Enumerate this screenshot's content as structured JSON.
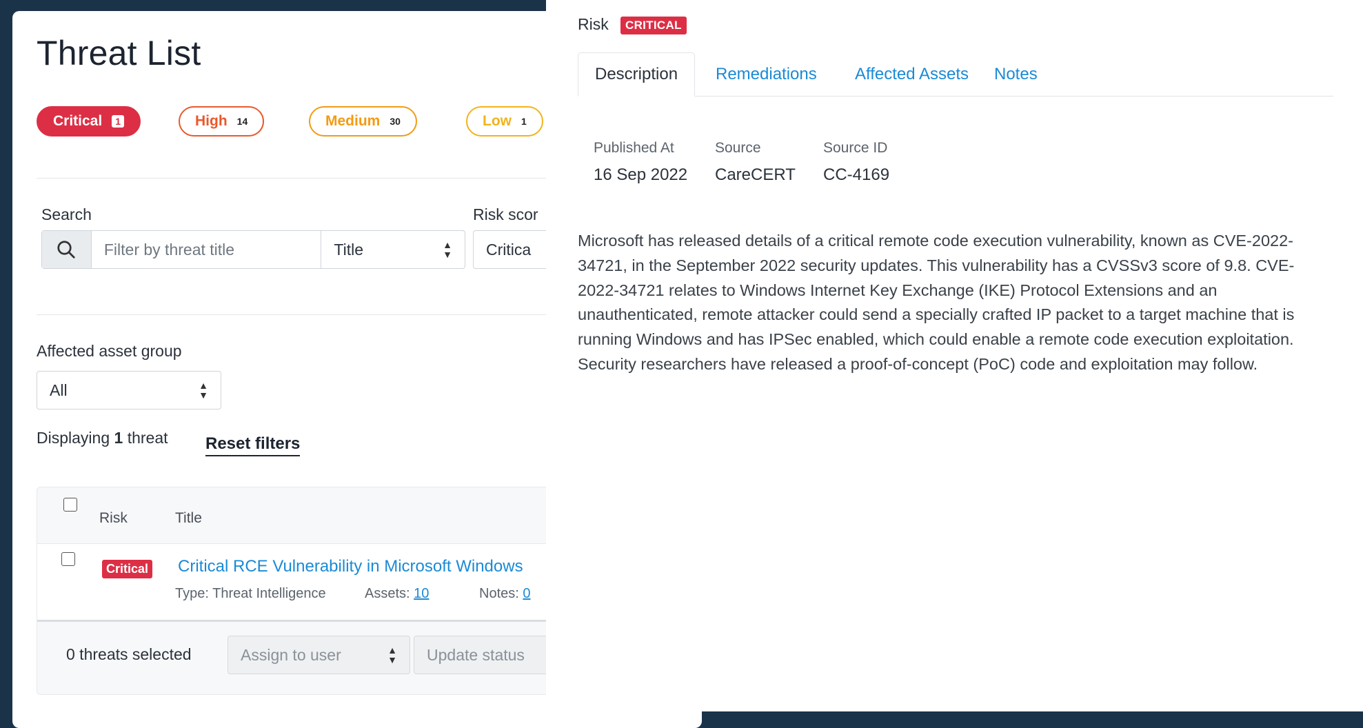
{
  "list": {
    "title": "Threat List",
    "filters": [
      {
        "label": "Critical",
        "count": "1"
      },
      {
        "label": "High",
        "count": "14"
      },
      {
        "label": "Medium",
        "count": "30"
      },
      {
        "label": "Low",
        "count": "1"
      }
    ],
    "search_label": "Search",
    "search_placeholder": "Filter by threat title",
    "search_field_select": "Title",
    "risk_score_label": "Risk scor",
    "risk_score_value": "Critica",
    "asset_group_label": "Affected asset group",
    "asset_group_value": "All",
    "displaying_prefix": "Displaying",
    "displaying_count": "1",
    "displaying_suffix": "threat",
    "reset_filters": "Reset filters",
    "table": {
      "col_risk": "Risk",
      "col_title": "Title",
      "rows": [
        {
          "risk": "Critical",
          "title": "Critical RCE Vulnerability in Microsoft Windows",
          "type": "Type: Threat Intelligence",
          "assets_label": "Assets:",
          "assets_count": "10",
          "notes_label": "Notes:",
          "notes_count": "0"
        }
      ]
    },
    "selected_text": "0 threats selected",
    "assign_placeholder": "Assign to user",
    "update_status": "Update status"
  },
  "detail": {
    "risk_label": "Risk",
    "risk_badge": "CRITICAL",
    "tabs": [
      "Description",
      "Remediations",
      "Affected Assets",
      "Notes"
    ],
    "published_label": "Published At",
    "published_value": "16 Sep 2022",
    "source_label": "Source",
    "source_value": "CareCERT",
    "source_id_label": "Source ID",
    "source_id_value": "CC-4169",
    "description": "Microsoft has released details of a critical remote code execution vulnerability, known as CVE-2022-34721, in the September 2022 security updates. This vulnerability has a CVSSv3 score of 9.8. CVE-2022-34721 relates to Windows Internet Key Exchange (IKE) Protocol Extensions and an unauthenticated, remote attacker could send a specially crafted IP packet to a target machine that is running Windows and has IPSec enabled, which could enable a remote code execution exploitation. Security researchers have released a proof-of-concept (PoC) code and exploitation may follow."
  },
  "colors": {
    "critical": "#dc2f45",
    "high": "#e9582c",
    "medium": "#f29b14",
    "low": "#f2b31a",
    "link": "#1a8ad6",
    "backdrop": "#1b3349"
  }
}
